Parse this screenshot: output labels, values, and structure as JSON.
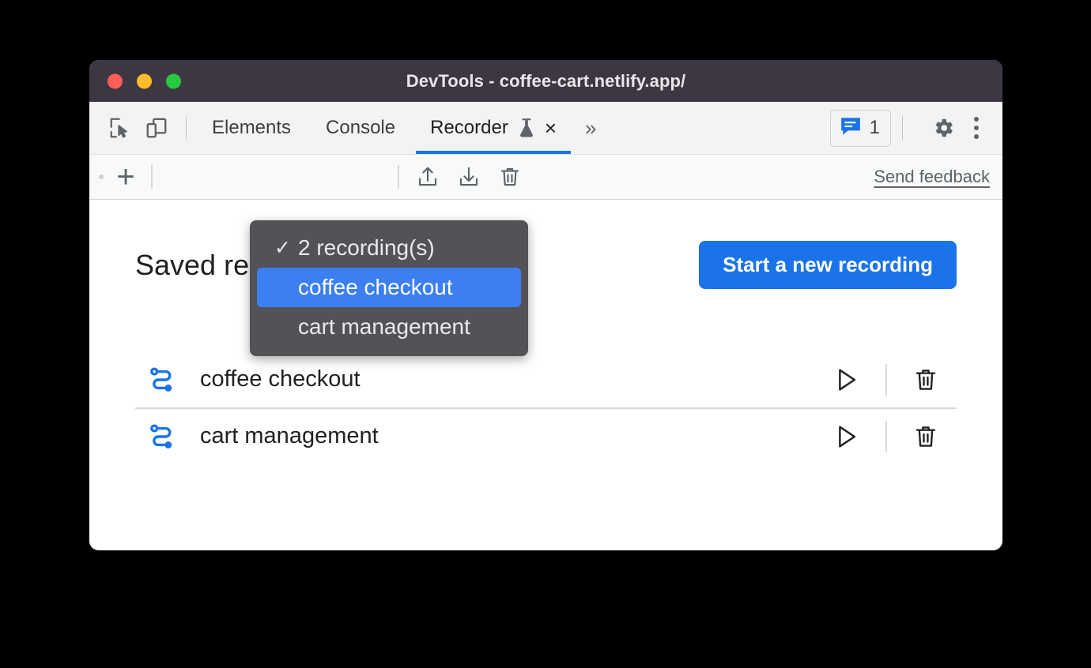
{
  "window": {
    "title": "DevTools - coffee-cart.netlify.app/",
    "traffic_lights": [
      "close",
      "minimize",
      "maximize"
    ]
  },
  "tabbar": {
    "left_icons": [
      {
        "name": "inspect-element-icon",
        "label": "Inspect element"
      },
      {
        "name": "device-toolbar-icon",
        "label": "Toggle device toolbar"
      }
    ],
    "tabs": [
      {
        "label": "Elements",
        "active": false
      },
      {
        "label": "Console",
        "active": false
      },
      {
        "label": "Recorder",
        "active": true,
        "experimental": true,
        "closable": true
      }
    ],
    "more_tabs_label": "»",
    "close_glyph": "×",
    "issues": {
      "icon": "issues-message-icon",
      "count": "1"
    },
    "settings_label": "Settings",
    "kebab_label": "Customize and control DevTools"
  },
  "recorder_toolbar": {
    "add_label": "+",
    "selected_recording": "2 recording(s)",
    "actions": [
      {
        "name": "import-recording-icon",
        "label": "Import recording"
      },
      {
        "name": "export-recording-icon",
        "label": "Export recording"
      },
      {
        "name": "delete-recording-icon",
        "label": "Delete recording"
      }
    ],
    "feedback_label": "Send feedback"
  },
  "dropdown": {
    "visible": true,
    "items": [
      {
        "label": "2 recording(s)",
        "checked": true,
        "selected": false
      },
      {
        "label": "coffee checkout",
        "checked": false,
        "selected": true
      },
      {
        "label": "cart management",
        "checked": false,
        "selected": false
      }
    ],
    "check_glyph": "✓",
    "background_color": "#545257",
    "highlight_color": "#3b7ff2"
  },
  "content": {
    "page_title": "Saved recordings",
    "start_button_label": "Start a new recording",
    "accent_color": "#1a73e8",
    "recordings": [
      {
        "name": "coffee checkout",
        "icon": "recording-flow-icon",
        "play_label": "Replay",
        "delete_label": "Delete"
      },
      {
        "name": "cart management",
        "icon": "recording-flow-icon",
        "play_label": "Replay",
        "delete_label": "Delete"
      }
    ]
  }
}
